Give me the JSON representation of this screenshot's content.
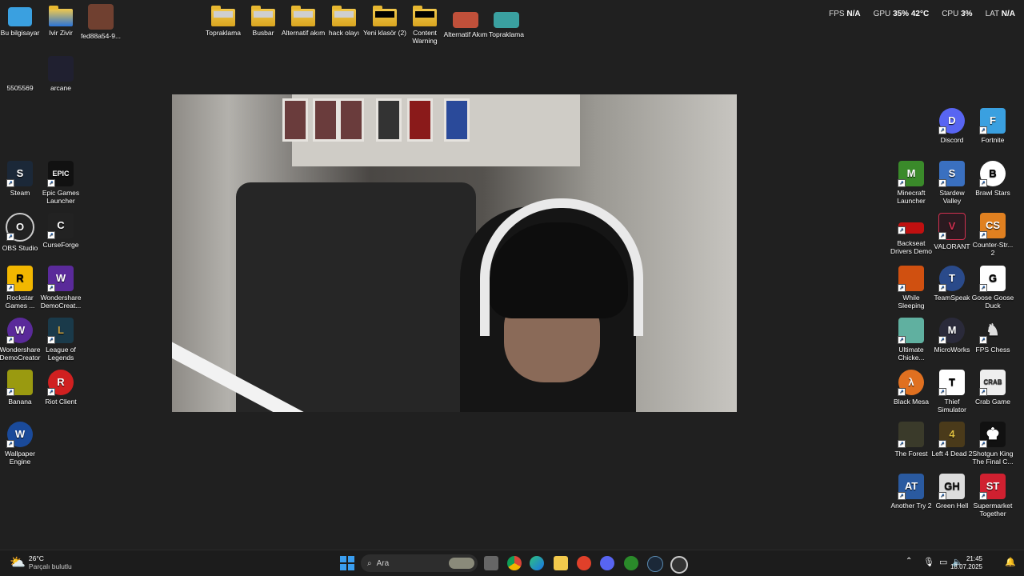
{
  "hud": {
    "fps_label": "FPS",
    "fps_value": "N/A",
    "gpu_label": "GPU",
    "gpu_value": "35% 42°C",
    "cpu_label": "CPU",
    "cpu_value": "3%",
    "lat_label": "LAT",
    "lat_value": "N/A"
  },
  "left_icons": [
    {
      "label": "Bu bilgisayar",
      "color": "#3aa0e0",
      "glyph": ""
    },
    {
      "label": "Ivir Zivir",
      "color": "#2a73d8",
      "glyph": ""
    },
    {
      "label": "fed88a54-9...",
      "color": "#704030",
      "glyph": ""
    },
    {
      "label": "5505569",
      "color": "#202020",
      "glyph": ""
    },
    {
      "label": "arcane",
      "color": "#202030",
      "glyph": ""
    },
    {
      "label": "Steam",
      "color": "#1b2838",
      "glyph": "S"
    },
    {
      "label": "Epic Games Launcher",
      "color": "#111111",
      "glyph": "EPIC"
    },
    {
      "label": "OBS Studio",
      "color": "#222222",
      "glyph": "O"
    },
    {
      "label": "CurseForge",
      "color": "#222222",
      "glyph": "C"
    },
    {
      "label": "Rockstar Games ...",
      "color": "#f2b700",
      "glyph": "R"
    },
    {
      "label": "Wondershare DemoCreat...",
      "color": "#5a2a9a",
      "glyph": "W"
    },
    {
      "label": "Wondershare DemoCreator",
      "color": "#5a2a9a",
      "glyph": "W"
    },
    {
      "label": "League of Legends",
      "color": "#1a3a4a",
      "glyph": "L"
    },
    {
      "label": "Banana",
      "color": "#9a9a10",
      "glyph": ""
    },
    {
      "label": "Riot Client",
      "color": "#d02020",
      "glyph": "R"
    },
    {
      "label": "Wallpaper Engine",
      "color": "#1a4a9a",
      "glyph": "W"
    }
  ],
  "top_folders": [
    {
      "label": "Topraklama"
    },
    {
      "label": "Busbar"
    },
    {
      "label": "Alternatif akım"
    },
    {
      "label": "hack olayı"
    },
    {
      "label": "Yeni klasör (2)"
    },
    {
      "label": "Content Warning"
    },
    {
      "label": "Alternatif Akım"
    },
    {
      "label": "Topraklama"
    }
  ],
  "right_icons": [
    {
      "label": "Discord",
      "color": "#5865f2",
      "glyph": "D"
    },
    {
      "label": "Fortnite",
      "color": "#3aa0e0",
      "glyph": "F"
    },
    {
      "label": "Minecraft Launcher",
      "color": "#3a8a2a",
      "glyph": "M"
    },
    {
      "label": "Stardew Valley",
      "color": "#3a70c0",
      "glyph": "S"
    },
    {
      "label": "Brawl Stars",
      "color": "#ffffff",
      "glyph": "B"
    },
    {
      "label": "Backseat Drivers Demo",
      "color": "#c01010",
      "glyph": ""
    },
    {
      "label": "VALORANT",
      "color": "#d03050",
      "glyph": "V"
    },
    {
      "label": "Counter-Str... 2",
      "color": "#e08020",
      "glyph": "CS"
    },
    {
      "label": "While Sleeping",
      "color": "#d05010",
      "glyph": ""
    },
    {
      "label": "TeamSpeak",
      "color": "#2a4a8a",
      "glyph": "T"
    },
    {
      "label": "Goose Goose Duck",
      "color": "#ffffff",
      "glyph": "G"
    },
    {
      "label": "Ultimate Chicke...",
      "color": "#60b0a0",
      "glyph": ""
    },
    {
      "label": "MicroWorks",
      "color": "#2a2a3a",
      "glyph": "M"
    },
    {
      "label": "FPS Chess",
      "color": "#dddddd",
      "glyph": "♞"
    },
    {
      "label": "Black Mesa",
      "color": "#e07020",
      "glyph": "λ"
    },
    {
      "label": "Thief Simulator",
      "color": "#ffffff",
      "glyph": "T"
    },
    {
      "label": "Crab Game",
      "color": "#eeeeee",
      "glyph": "CRAB"
    },
    {
      "label": "The Forest",
      "color": "#3a3a2a",
      "glyph": ""
    },
    {
      "label": "Left 4 Dead 2",
      "color": "#4a3a1a",
      "glyph": "4"
    },
    {
      "label": "Shotgun King The Final C...",
      "color": "#111111",
      "glyph": "♚"
    },
    {
      "label": "Another Try 2",
      "color": "#2a5aa0",
      "glyph": "AT"
    },
    {
      "label": "Green Hell",
      "color": "#dddddd",
      "glyph": "GH"
    },
    {
      "label": "Supermarket Together",
      "color": "#d02030",
      "glyph": "ST"
    }
  ],
  "taskbar": {
    "weather_temp": "26°C",
    "weather_desc": "Parçalı bulutlu",
    "search_placeholder": "Ara",
    "time": "21:45",
    "date": "18.07.2025"
  }
}
